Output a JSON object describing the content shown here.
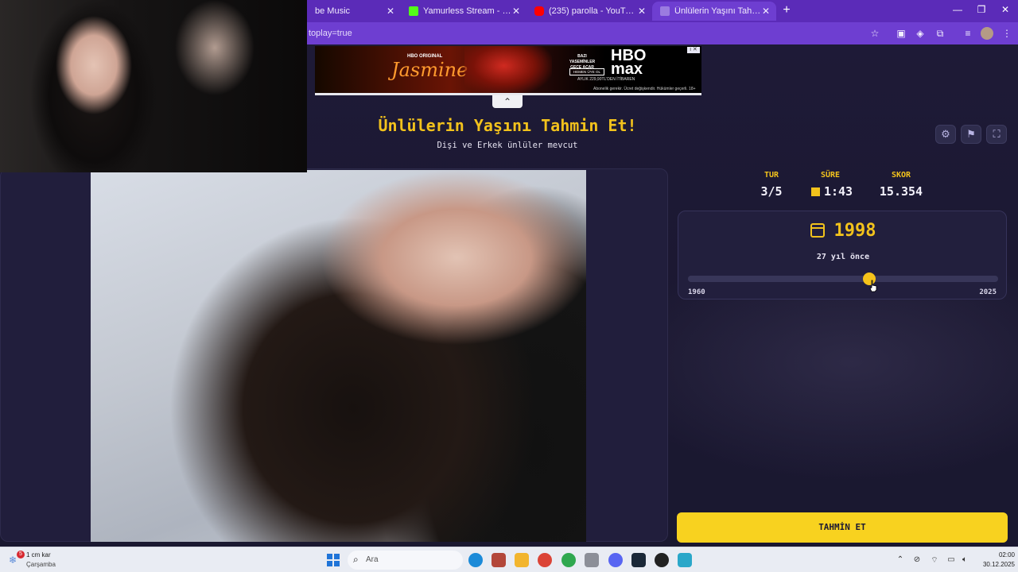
{
  "browser": {
    "tabs": [
      {
        "label": "be Music",
        "favicon_color": "#ff3d2e"
      },
      {
        "label": "Yamurless Stream - Watch Live",
        "favicon_color": "#53fc18"
      },
      {
        "label": "(235) parolla - YouTube",
        "favicon_color": "#ff0000"
      },
      {
        "label": "Ünlülerin Yaşını Tahmin Et! - Qu",
        "favicon_color": "#9b7be0"
      }
    ],
    "address": "toplay=true",
    "accent": "#5b2bb8"
  },
  "ad": {
    "brand_top": "HBO ORIGINAL",
    "show": "Jasmine",
    "promo_line1": "BAZI YASEMİNLER GECE AÇAR",
    "cta": "HEMEN ÜYE OL",
    "price": "AYLIK 229,90TL'DEN İTİBAREN",
    "logo": "HBO max",
    "fine_print": "Abonelik gerekir. Ücret değişkendir. Hükümler geçerli. 18+"
  },
  "game": {
    "title": "Ünlülerin Yaşını Tahmin Et!",
    "subtitle": "Dişi ve Erkek ünlüler mevcut",
    "stats": {
      "round_label": "TUR",
      "round_value": "3/5",
      "time_label": "SÜRE",
      "time_value": "1:43",
      "score_label": "SKOR",
      "score_value": "15.354"
    },
    "year": {
      "value": "1998",
      "ago": "27 yıl önce",
      "min": "1960",
      "max": "2025",
      "slider_fraction": 0.585
    },
    "guess_button": "TAHMİN ET",
    "accent": "#f2c21c"
  },
  "taskbar": {
    "weather_temp": "1 cm kar",
    "weather_day": "Çarşamba",
    "notification_count": "5",
    "search_placeholder": "Ara",
    "time": "02:00",
    "date": "30.12.2025"
  }
}
